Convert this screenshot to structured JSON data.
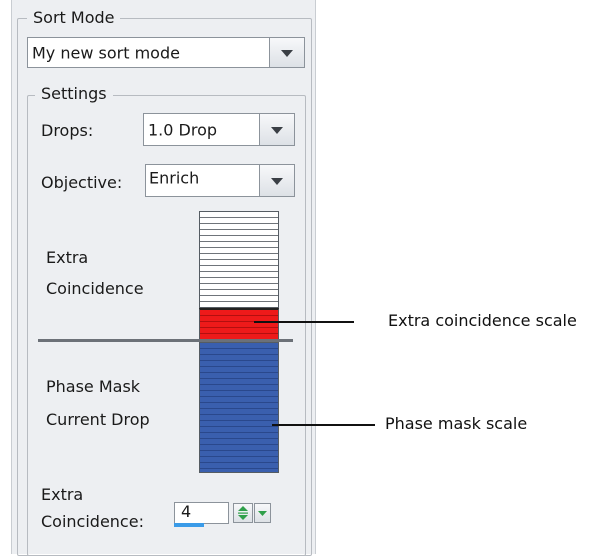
{
  "sort_mode": {
    "legend": "Sort Mode",
    "selected": "My new sort mode"
  },
  "settings": {
    "legend": "Settings",
    "drops_label": "Drops:",
    "drops_value": "1.0 Drop",
    "objective_label": "Objective:",
    "objective_value": "Enrich",
    "extra_coincidence_label_line1": "Extra",
    "extra_coincidence_label_line2": "Coincidence",
    "phase_mask_label_line1": "Phase Mask",
    "phase_mask_label_line2": "Current Drop",
    "extra_coincidence_field_line1": "Extra",
    "extra_coincidence_field_line2": "Coincidence:",
    "extra_coincidence_value": "4"
  },
  "callouts": {
    "extra_coincidence_scale": "Extra coincidence scale",
    "phase_mask_scale": "Phase mask scale"
  },
  "colors": {
    "coincidence_fill": "#ee1a1a",
    "phase_mask_fill": "#3a5fae",
    "spinner_accent": "#2f9f4a",
    "value_bar": "#3a9be8"
  },
  "icons": {
    "combo_arrow": "chevron-down-icon",
    "spin_up": "arrow-up-icon",
    "spin_down": "arrow-down-icon"
  }
}
